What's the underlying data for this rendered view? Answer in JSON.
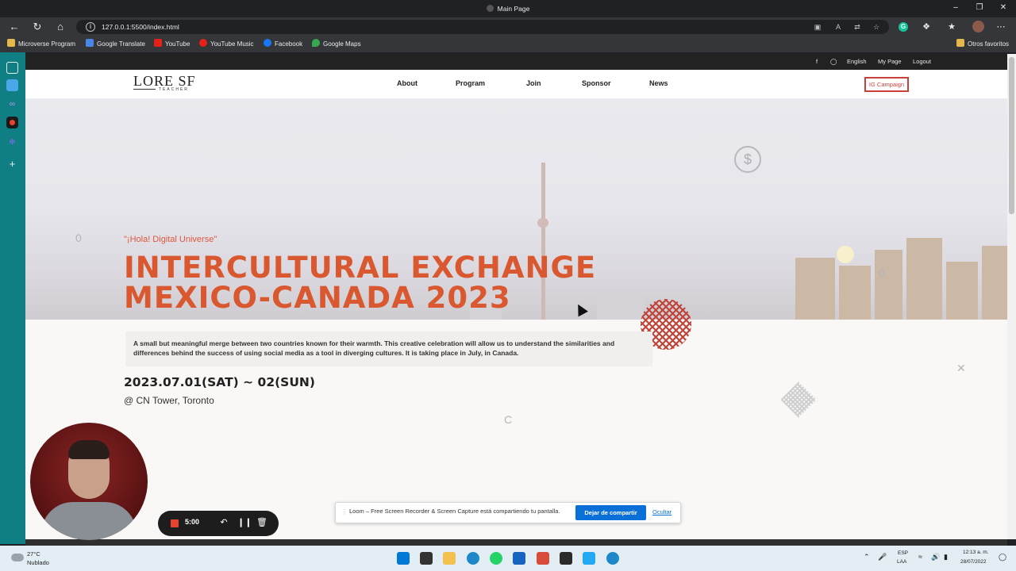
{
  "browser": {
    "window_title": "Main Page",
    "url": "127.0.0.1:5500/index.html",
    "bookmarks": [
      "Microverse Program",
      "Google Translate",
      "YouTube",
      "YouTube Music",
      "Facebook",
      "Google Maps"
    ],
    "other_favorites": "Otros favoritos"
  },
  "site": {
    "topbar": {
      "language": "English",
      "my_page": "My Page",
      "logout": "Logout"
    },
    "logo": {
      "main": "LORE SF",
      "sub": "TEACHER"
    },
    "nav": [
      "About",
      "Program",
      "Join",
      "Sponsor",
      "News"
    ],
    "cta": "IG Campaign",
    "hero": {
      "tag": "\"¡Hola! Digital Universe\"",
      "headline_line1": "INTERCULTURAL EXCHANGE",
      "headline_line2": "MEXICO-CANADA 2023",
      "description": "A small but meaningful merge between two countries known for their warmth. This creative celebration will allow us to understand the similarities and differences behind the success of using social media as a tool in diverging cultures. It is taking place in July, in Canada.",
      "date": "2023.07.01(SAT) ~ 02(SUN)",
      "location": "@ CN Tower, Toronto"
    },
    "deco_glyphs": {
      "zero": "0",
      "c": "C",
      "x": "✕"
    }
  },
  "recorder": {
    "time": "5:00"
  },
  "loom_banner": {
    "message": "Loom – Free Screen Recorder & Screen Capture está compartiendo tu pantalla.",
    "stop_button": "Dejar de compartir",
    "hide_link": "Ocultar"
  },
  "taskbar": {
    "temperature": "27°C",
    "condition": "Nublado",
    "lang_line1": "ESP",
    "lang_line2": "LAA",
    "time": "12:13 a. m.",
    "date": "28/07/2022"
  },
  "colors": {
    "accent": "#d9582f",
    "cta_border": "#c9413a",
    "loom_blue": "#0a6fd6",
    "sidebar_teal": "#0f7f83"
  }
}
